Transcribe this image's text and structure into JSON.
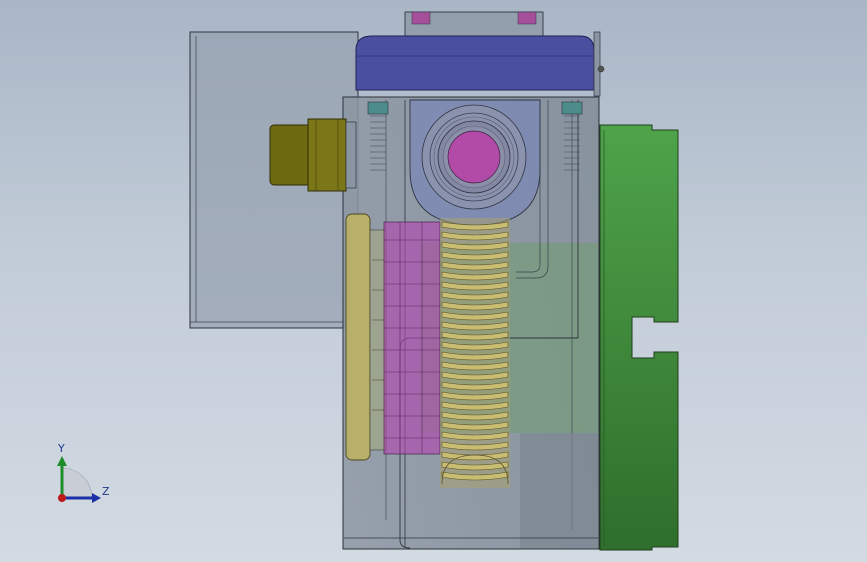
{
  "viewport": {
    "background_top": "#a9b6c6",
    "background_bottom": "#d3dae3"
  },
  "model": {
    "parts": [
      {
        "name": "rear-housing",
        "color": "#8f99a8"
      },
      {
        "name": "top-cover",
        "color": "#4b4fa0"
      },
      {
        "name": "gear-case",
        "color": "#8a949e"
      },
      {
        "name": "right-flange",
        "color": "#3f8f3c"
      },
      {
        "name": "motor-shaft",
        "color": "#6e6a12"
      },
      {
        "name": "bearing",
        "color": "#9a5a9a"
      },
      {
        "name": "worm-screw",
        "color": "#b9ad63"
      },
      {
        "name": "left-plate",
        "color": "#b8b06a"
      },
      {
        "name": "magenta-gear",
        "color": "#b04ab0"
      }
    ]
  },
  "triad": {
    "y_label": "Y",
    "z_label": "Z",
    "y_color": "#1d8c2a",
    "z_color": "#1b2fa8",
    "x_color": "#c01818"
  }
}
